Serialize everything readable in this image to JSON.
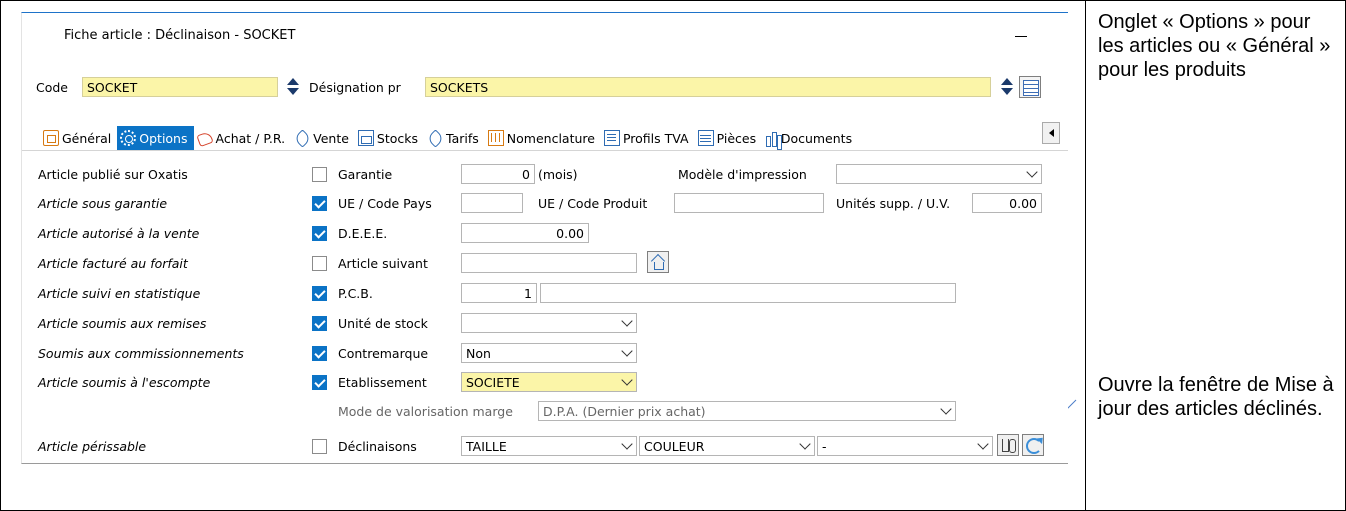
{
  "notes": {
    "tab_note": "Onglet « Options » pour les articles ou « Général » pour les produits",
    "update_note": "Ouvre la fenêtre de Mise à jour des articles déclinés."
  },
  "window": {
    "title": "Fiche article : Déclinaison - SOCKET",
    "minimize": "–"
  },
  "header": {
    "code_label": "Code",
    "code_value": "SOCKET",
    "designation_label": "Désignation pr",
    "designation_value": "SOCKETS"
  },
  "tabs": [
    {
      "label": "Général",
      "icon": "document-icon"
    },
    {
      "label": "Options",
      "icon": "gear-icon"
    },
    {
      "label": "Achat / P.R.",
      "icon": "cart-icon"
    },
    {
      "label": "Vente",
      "icon": "tag-icon"
    },
    {
      "label": "Stocks",
      "icon": "stock-icon"
    },
    {
      "label": "Tarifs",
      "icon": "tarif-icon"
    },
    {
      "label": "Nomenclature",
      "icon": "nomenclature-icon"
    },
    {
      "label": "Profils TVA",
      "icon": "tva-icon"
    },
    {
      "label": "Pièces",
      "icon": "pieces-icon"
    },
    {
      "label": "Documents",
      "icon": "documents-icon"
    }
  ],
  "left_rows": [
    {
      "label": "Article publié sur Oxatis",
      "italic": false,
      "checked": false
    },
    {
      "label": "Article sous garantie",
      "italic": true,
      "checked": true
    },
    {
      "label": "Article autorisé à la vente",
      "italic": true,
      "checked": true
    },
    {
      "label": "Article facturé au forfait",
      "italic": true,
      "checked": false
    },
    {
      "label": "Article suivi en statistique",
      "italic": true,
      "checked": true
    },
    {
      "label": "Article soumis aux remises",
      "italic": true,
      "checked": true
    },
    {
      "label": "Soumis aux commissionnements",
      "italic": true,
      "checked": true
    },
    {
      "label": "Article soumis à l'escompte",
      "italic": true,
      "checked": true
    },
    {
      "label": "Article périssable",
      "italic": true,
      "checked": false
    }
  ],
  "fields": {
    "garantie_label": "Garantie",
    "garantie_value": "0",
    "garantie_unit": "(mois)",
    "modele_label": "Modèle d'impression",
    "modele_value": "",
    "ue_pays_label": "UE / Code Pays",
    "ue_pays_value": "",
    "ue_produit_label": "UE / Code Produit",
    "ue_produit_value": "",
    "unites_label": "Unités supp. / U.V.",
    "unites_value": "0.00",
    "deee_label": "D.E.E.E.",
    "deee_value": "0.00",
    "suivant_label": "Article suivant",
    "suivant_value": "",
    "pcb_label": "P.C.B.",
    "pcb_value": "1",
    "pcb_extra": "",
    "unite_stock_label": "Unité de stock",
    "unite_stock_value": "",
    "contremarque_label": "Contremarque",
    "contremarque_value": "Non",
    "etablissement_label": "Etablissement",
    "etablissement_value": "SOCIETE",
    "valorisation_label": "Mode de valorisation marge",
    "valorisation_value": "D.P.A. (Dernier prix achat)",
    "declinaisons_label": "Déclinaisons",
    "decl1": "TAILLE",
    "decl2": "COULEUR",
    "decl3": "-"
  },
  "colors": {
    "accent": "#0b73c6",
    "yellow_field": "#fbf5a8"
  }
}
